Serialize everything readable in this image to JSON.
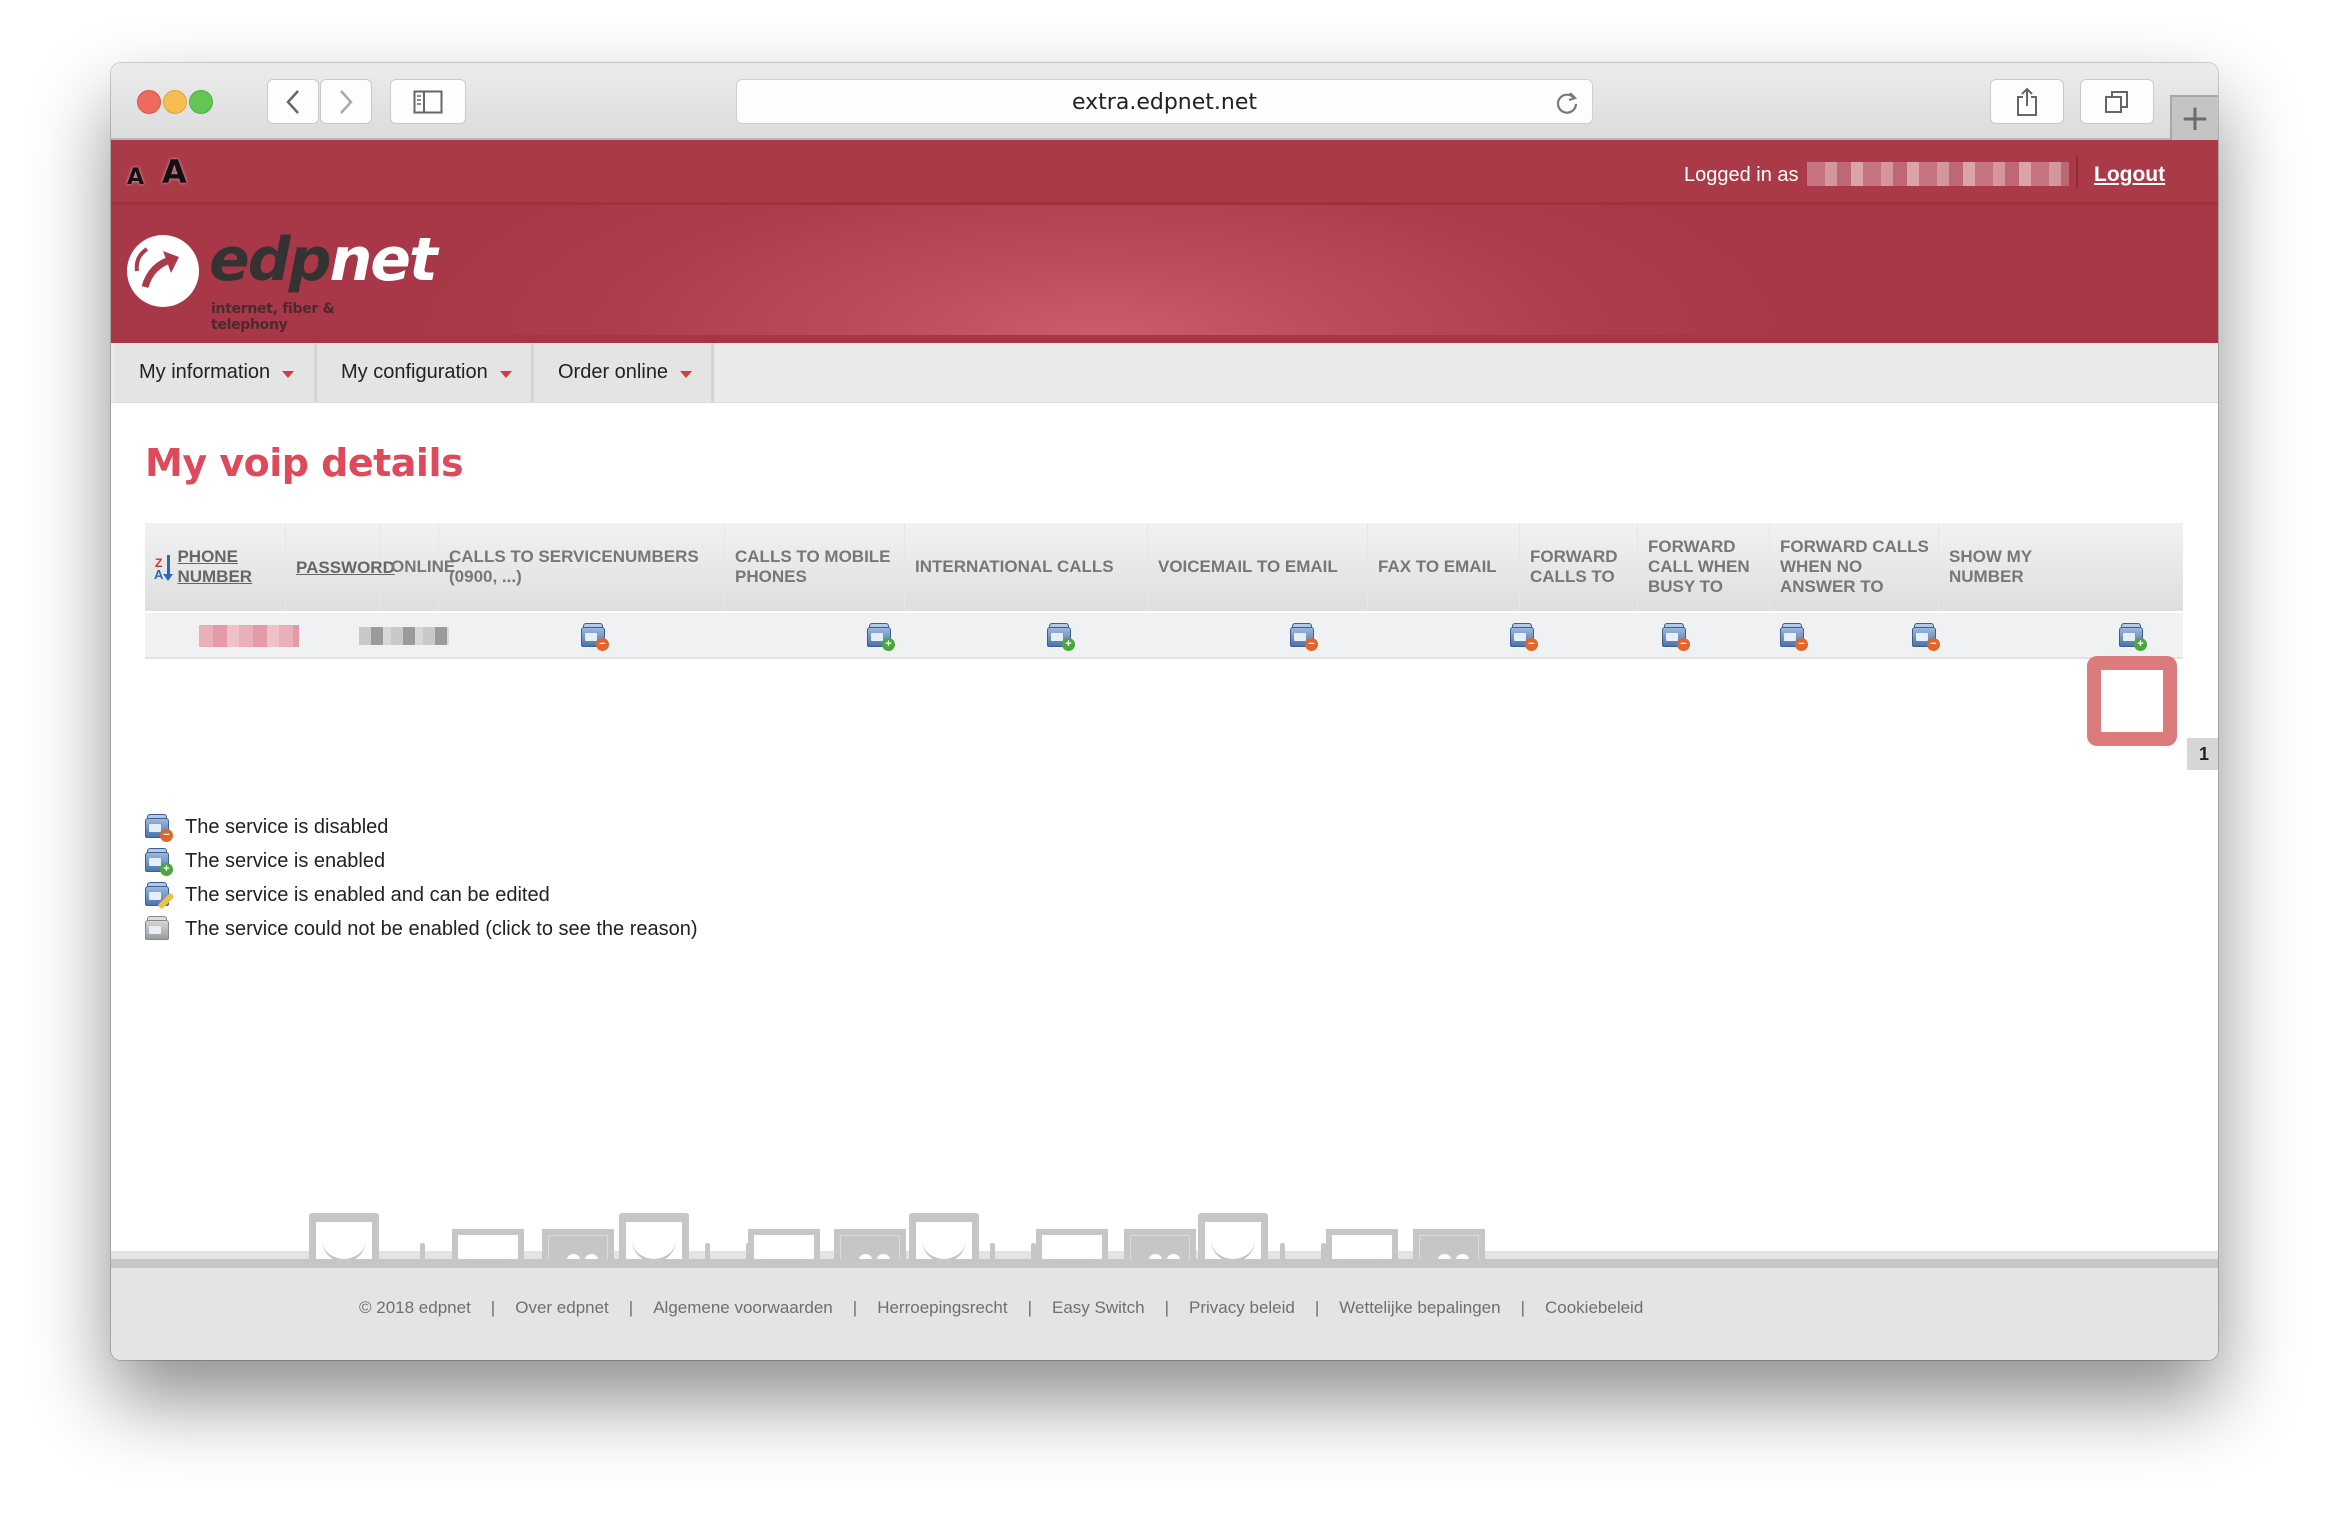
{
  "browser": {
    "url": "extra.edpnet.net",
    "buttons": {
      "back": "back",
      "forward": "forward",
      "sidebar": "sidebar",
      "share": "share",
      "tabs": "tabs",
      "new_tab": "+"
    }
  },
  "topbar": {
    "font_small": "A",
    "font_large": "A",
    "logged_in_label": "Logged in as",
    "logout_label": "Logout"
  },
  "brand": {
    "name_dark": "edp",
    "name_light": "net",
    "tagline": "internet, fiber & telephony",
    "colors": {
      "primary": "#aa3a48",
      "title": "#dc4a5c"
    }
  },
  "nav": {
    "items": [
      {
        "label": "My information"
      },
      {
        "label": "My configuration"
      },
      {
        "label": "Order online"
      }
    ]
  },
  "page": {
    "title": "My voip details"
  },
  "table": {
    "columns": [
      {
        "label": "PHONE NUMBER",
        "sortable": true,
        "sorted": "z-a"
      },
      {
        "label": "PASSWORD",
        "sortable": true
      },
      {
        "label": "ONLINE"
      },
      {
        "label": "CALLS TO SERVICENUMBERS (0900, ...)"
      },
      {
        "label": "CALLS TO MOBILE PHONES"
      },
      {
        "label": "INTERNATIONAL CALLS"
      },
      {
        "label": "VOICEMAIL TO EMAIL"
      },
      {
        "label": "FAX TO EMAIL"
      },
      {
        "label": "FORWARD CALLS TO"
      },
      {
        "label": "FORWARD CALL WHEN BUSY TO"
      },
      {
        "label": "FORWARD CALLS WHEN NO ANSWER TO"
      },
      {
        "label": "SHOW MY NUMBER"
      }
    ],
    "rows": [
      {
        "phone_number": "[redacted]",
        "password": "[redacted]",
        "online": "",
        "services": {
          "calls_to_servicenumbers": "disabled",
          "calls_to_mobile_phones": "enabled",
          "international_calls": "enabled",
          "voicemail_to_email": "disabled",
          "fax_to_email": "disabled",
          "forward_calls_to": "disabled",
          "forward_call_when_busy_to": "disabled",
          "forward_calls_when_no_answer_to": "disabled",
          "show_my_number": "enabled"
        }
      }
    ],
    "highlighted_cell": "show_my_number",
    "pagination": {
      "current_page": "1"
    }
  },
  "legend": [
    {
      "icon": "service-disabled-icon",
      "label": "The service is disabled"
    },
    {
      "icon": "service-enabled-icon",
      "label": "The service is enabled"
    },
    {
      "icon": "service-editable-icon",
      "label": "The service is enabled and can be edited"
    },
    {
      "icon": "service-unavailable-icon",
      "label": "The service could not be enabled (click to see the reason)"
    }
  ],
  "footer": {
    "links": [
      "© 2018 edpnet",
      "Over edpnet",
      "Algemene voorwaarden",
      "Herroepingsrecht",
      "Easy Switch",
      "Privacy beleid",
      "Wettelijke bepalingen",
      "Cookiebeleid"
    ],
    "separator": "|"
  }
}
